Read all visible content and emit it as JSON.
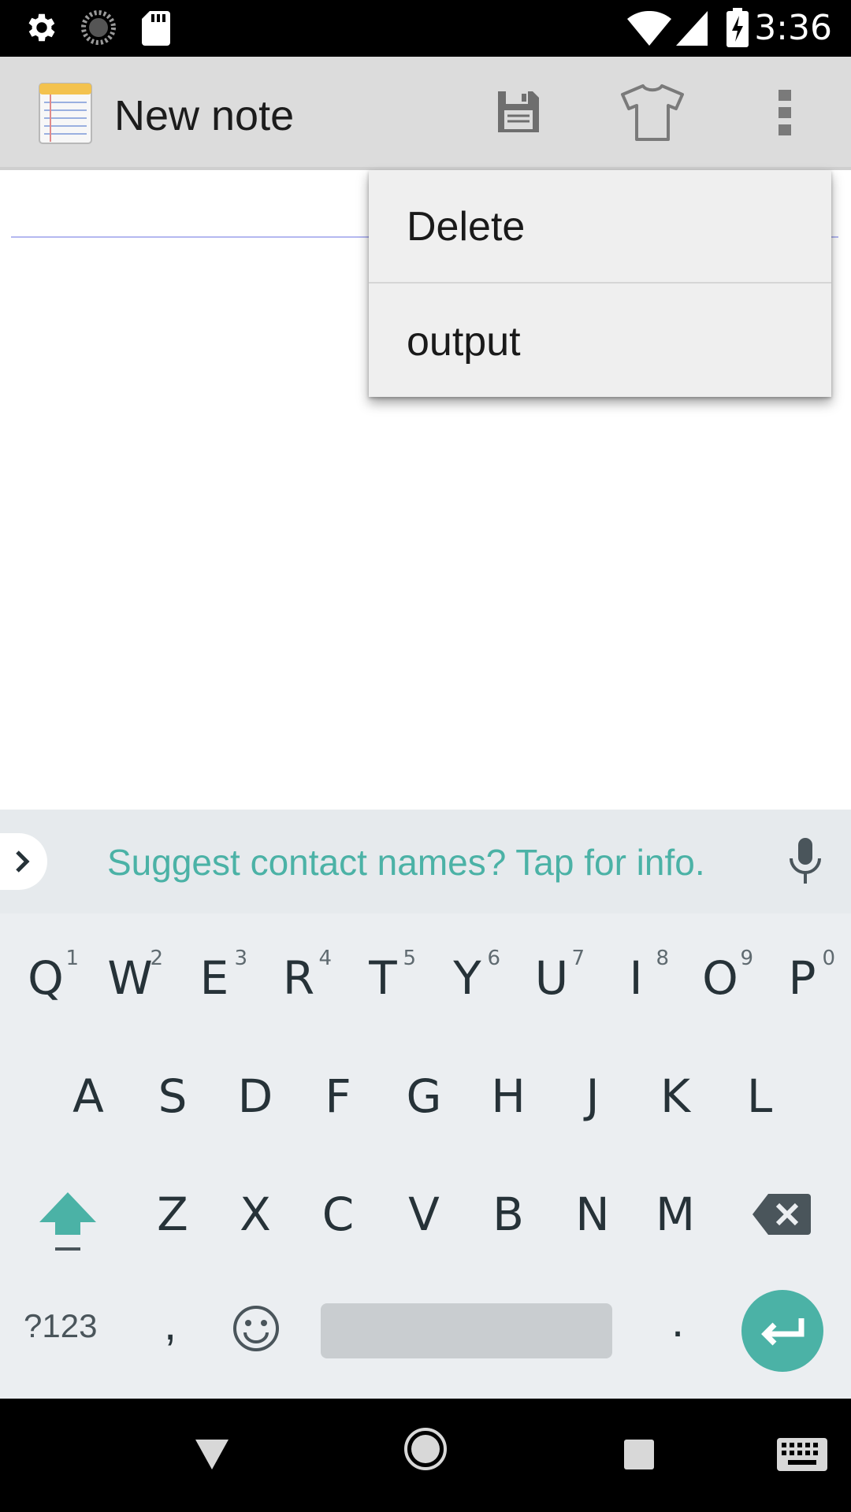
{
  "status_bar": {
    "time": "3:36",
    "icons": [
      "settings-icon",
      "sync-icon",
      "sd-card-icon",
      "wifi-icon",
      "signal-icon",
      "battery-charging-icon"
    ]
  },
  "action_bar": {
    "title": "New note",
    "app_icon": "notepad-icon",
    "buttons": [
      "save-icon",
      "theme-shirt-icon",
      "overflow-menu-icon"
    ]
  },
  "popup_menu": {
    "items": [
      {
        "label": "Delete"
      },
      {
        "label": "output"
      }
    ]
  },
  "note": {
    "text": ""
  },
  "suggestion_strip": {
    "text": "Suggest contact names? Tap for info."
  },
  "keyboard": {
    "row1": [
      {
        "label": "Q",
        "hint": "1"
      },
      {
        "label": "W",
        "hint": "2"
      },
      {
        "label": "E",
        "hint": "3"
      },
      {
        "label": "R",
        "hint": "4"
      },
      {
        "label": "T",
        "hint": "5"
      },
      {
        "label": "Y",
        "hint": "6"
      },
      {
        "label": "U",
        "hint": "7"
      },
      {
        "label": "I",
        "hint": "8"
      },
      {
        "label": "O",
        "hint": "9"
      },
      {
        "label": "P",
        "hint": "0"
      }
    ],
    "row2": [
      "A",
      "S",
      "D",
      "F",
      "G",
      "H",
      "J",
      "K",
      "L"
    ],
    "row3": [
      "Z",
      "X",
      "C",
      "V",
      "B",
      "N",
      "M"
    ],
    "symbols_label": "?123",
    "comma": ",",
    "period": ".",
    "accent": "#4bb2a6"
  },
  "nav_bar": {
    "buttons": [
      "back-icon",
      "home-icon",
      "recents-icon",
      "keyboard-switch-icon"
    ]
  }
}
